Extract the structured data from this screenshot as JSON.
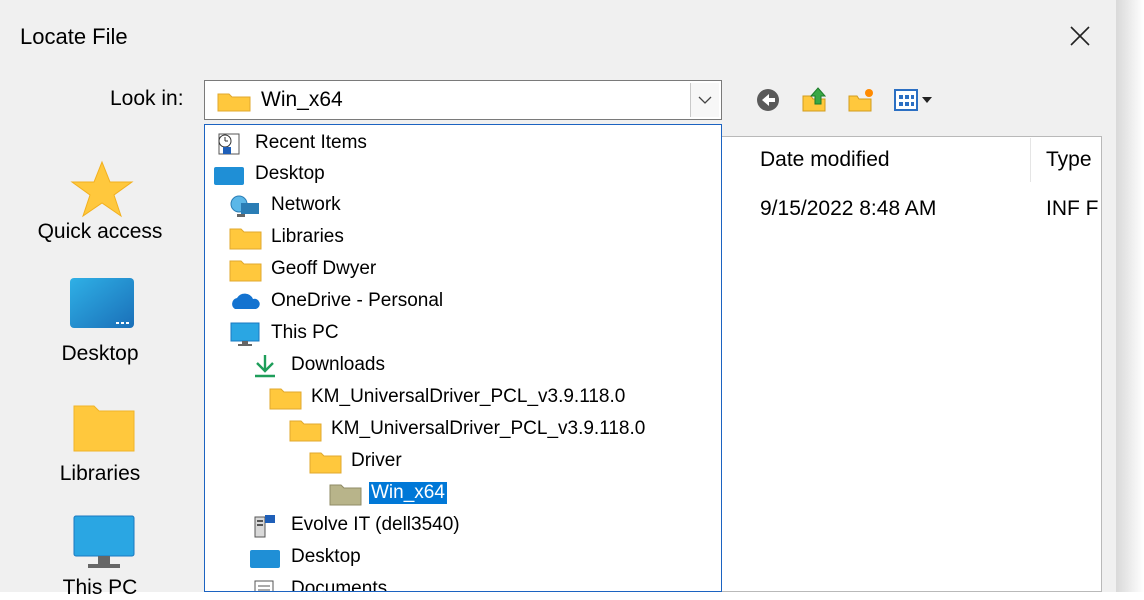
{
  "window": {
    "title": "Locate File",
    "close_icon": "close-icon"
  },
  "toolbar": {
    "look_in_label": "Look in:",
    "look_in_value": "Win_x64",
    "icons": [
      "back-icon",
      "up-folder-icon",
      "new-folder-icon",
      "view-menu-icon"
    ]
  },
  "places": [
    {
      "label": "Quick access",
      "icon": "star-icon"
    },
    {
      "label": "Desktop",
      "icon": "desktop-icon"
    },
    {
      "label": "Libraries",
      "icon": "folder-icon"
    },
    {
      "label": "This PC",
      "icon": "monitor-icon"
    }
  ],
  "file_list": {
    "columns": [
      "Date modified",
      "Type"
    ],
    "rows": [
      {
        "date_modified": "9/15/2022 8:48 AM",
        "type": "INF F"
      }
    ]
  },
  "dropdown": {
    "items": [
      {
        "label": "Recent Items",
        "icon": "recent-items-icon"
      },
      {
        "label": "Desktop",
        "icon": "desktop-icon"
      },
      {
        "label": "Network",
        "icon": "network-icon"
      },
      {
        "label": "Libraries",
        "icon": "folder-icon"
      },
      {
        "label": "Geoff Dwyer",
        "icon": "folder-icon"
      },
      {
        "label": "OneDrive - Personal",
        "icon": "cloud-icon"
      },
      {
        "label": "This PC",
        "icon": "monitor-icon"
      },
      {
        "label": "Downloads",
        "icon": "download-arrow-icon"
      },
      {
        "label": "KM_UniversalDriver_PCL_v3.9.118.0",
        "icon": "folder-icon"
      },
      {
        "label": "KM_UniversalDriver_PCL_v3.9.118.0",
        "icon": "folder-icon"
      },
      {
        "label": "Driver",
        "icon": "folder-icon"
      },
      {
        "label": "Win_x64",
        "icon": "folder-icon",
        "selected": true
      },
      {
        "label": "Evolve IT (dell3540)",
        "icon": "network-drive-icon"
      },
      {
        "label": "Desktop",
        "icon": "desktop-icon"
      },
      {
        "label": "Documents",
        "icon": "documents-icon"
      }
    ]
  },
  "colors": {
    "selection": "#0078d7",
    "folder": "#ffc83d",
    "accent_border": "#1c63c1"
  }
}
